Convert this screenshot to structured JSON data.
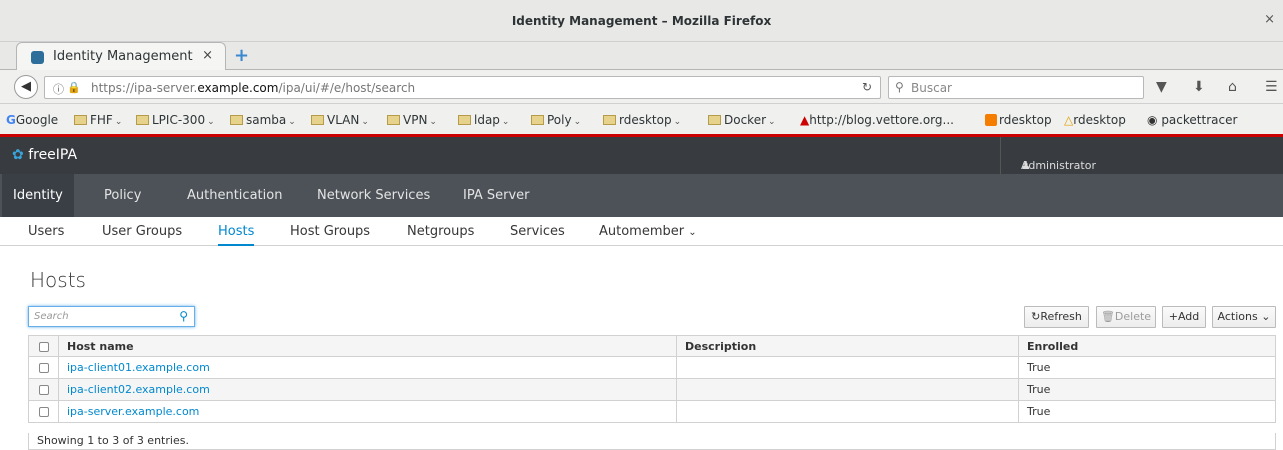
{
  "window": {
    "title": "Identity Management – Mozilla Firefox",
    "close": "×"
  },
  "tabs": [
    {
      "label": "Identity Management",
      "close": "×"
    }
  ],
  "new_tab": "+",
  "url": {
    "prefix": "https://ipa-server.",
    "domain": "example.com",
    "suffix": "/ipa/ui/#/e/host/search"
  },
  "search_box": {
    "placeholder": "Buscar"
  },
  "bookmarks": [
    {
      "label": "Google",
      "folder": false,
      "chevron": false,
      "icon": "google-icon"
    },
    {
      "label": "FHF",
      "folder": true,
      "chevron": true
    },
    {
      "label": "LPIC-300",
      "folder": true,
      "chevron": true
    },
    {
      "label": "samba",
      "folder": true,
      "chevron": true
    },
    {
      "label": "VLAN",
      "folder": true,
      "chevron": true
    },
    {
      "label": "VPN",
      "folder": true,
      "chevron": true
    },
    {
      "label": "ldap",
      "folder": true,
      "chevron": true
    },
    {
      "label": "Poly",
      "folder": true,
      "chevron": true
    },
    {
      "label": "rdesktop",
      "folder": true,
      "chevron": true
    },
    {
      "label": "Docker",
      "folder": true,
      "chevron": true
    },
    {
      "label": "http://blog.vettore.org...",
      "folder": false,
      "chevron": false,
      "icon": "vettore-icon"
    },
    {
      "label": "rdesktop",
      "folder": false,
      "chevron": false,
      "icon": "blogger-icon"
    },
    {
      "label": "rdesktop",
      "folder": false,
      "chevron": false,
      "icon": "linux-icon"
    },
    {
      "label": "packettracer",
      "folder": false,
      "chevron": false,
      "icon": "globe-icon"
    }
  ],
  "app": {
    "name": "freeIPA",
    "user": "Administrator"
  },
  "primary_nav": [
    "Identity",
    "Policy",
    "Authentication",
    "Network Services",
    "IPA Server"
  ],
  "primary_nav_active": "Identity",
  "secondary_nav": [
    "Users",
    "User Groups",
    "Hosts",
    "Host Groups",
    "Netgroups",
    "Services",
    "Automember"
  ],
  "secondary_nav_active": "Hosts",
  "page": {
    "title": "Hosts",
    "search_placeholder": "Search",
    "buttons": {
      "refresh": "Refresh",
      "delete": "Delete",
      "add": "Add",
      "actions": "Actions"
    }
  },
  "table": {
    "columns": [
      "Host name",
      "Description",
      "Enrolled"
    ],
    "rows": [
      {
        "host": "ipa-client01.example.com",
        "description": "",
        "enrolled": "True"
      },
      {
        "host": "ipa-client02.example.com",
        "description": "",
        "enrolled": "True"
      },
      {
        "host": "ipa-server.example.com",
        "description": "",
        "enrolled": "True"
      }
    ],
    "footer": "Showing 1 to 3 of 3 entries."
  },
  "colors": {
    "accent": "#0088ce",
    "header_bg": "#383b3f",
    "nav_bg": "#4d5258",
    "bookmark_border": "#cc0000"
  }
}
